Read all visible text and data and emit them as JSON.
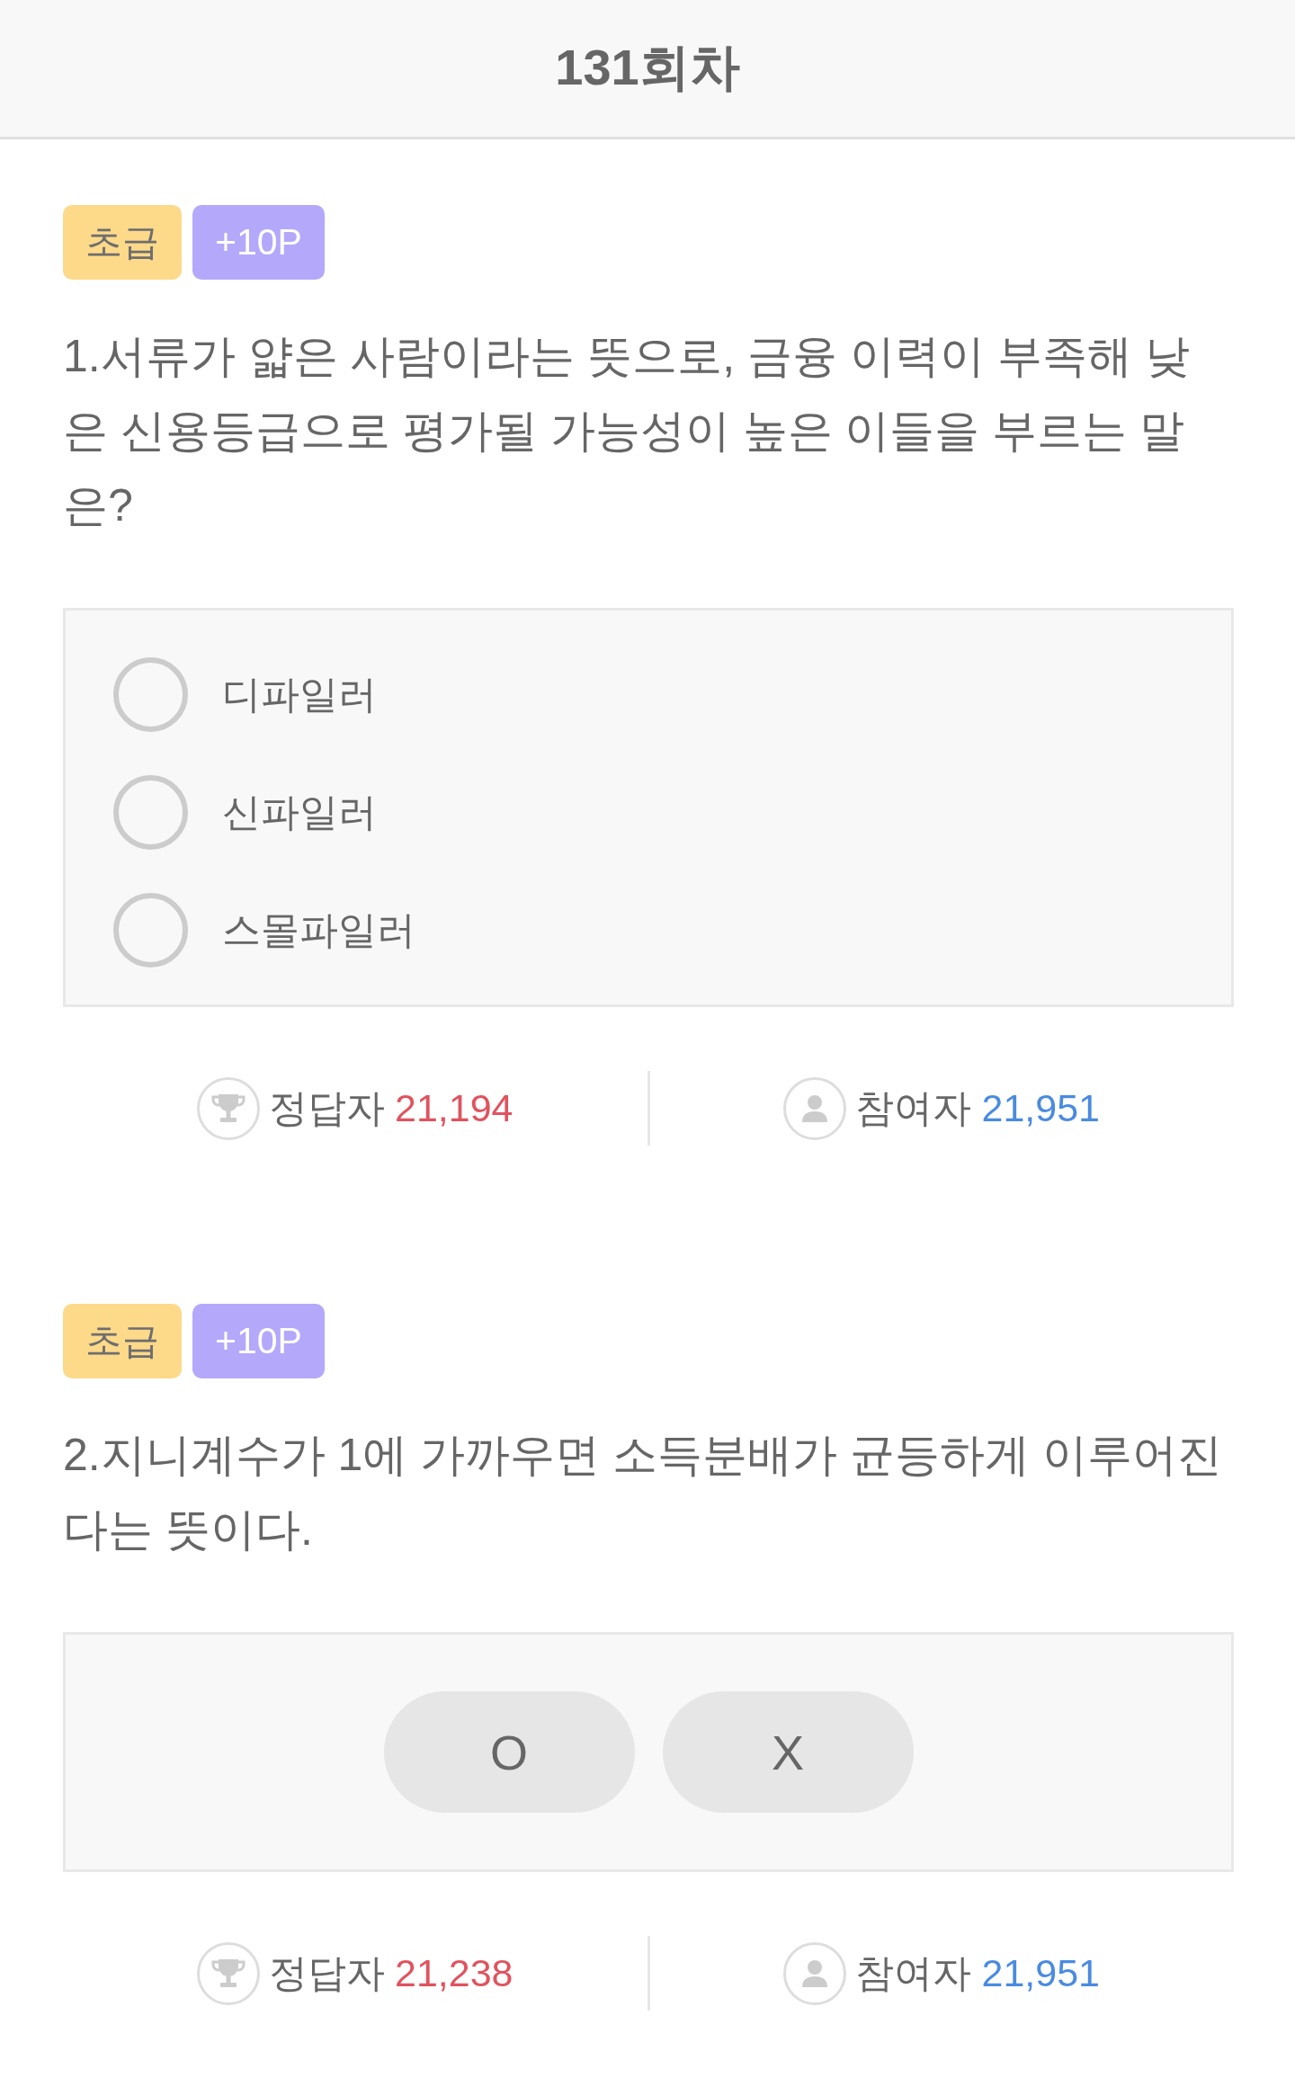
{
  "header": {
    "title": "131회차"
  },
  "questions": [
    {
      "kind": "choice",
      "badges": [
        {
          "kind": "level",
          "label": "초급"
        },
        {
          "kind": "points",
          "label": "+10P"
        }
      ],
      "text": "1.서류가 얇은 사람이라는 뜻으로, 금융 이력이 부족해 낮은 신용등급으로 평가될 가능성이 높은 이들을 부르는 말은?",
      "options": [
        {
          "label": "디파일러",
          "selected": false
        },
        {
          "label": "신파일러",
          "selected": false
        },
        {
          "label": "스몰파일러",
          "selected": false
        }
      ],
      "stats": [
        {
          "kind": "correct",
          "label": "정답자",
          "count": "21,194"
        },
        {
          "kind": "participants",
          "label": "참여자",
          "count": "21,951"
        }
      ]
    },
    {
      "kind": "ox",
      "badges": [
        {
          "kind": "level",
          "label": "초급"
        },
        {
          "kind": "points",
          "label": "+10P"
        }
      ],
      "text": "2.지니계수가 1에 가까우면 소득분배가 균등하게 이루어진다는 뜻이다.",
      "answers": [
        {
          "label": "O",
          "selected": false
        },
        {
          "label": "X",
          "selected": false
        }
      ],
      "stats": [
        {
          "kind": "correct",
          "label": "정답자",
          "count": "21,238"
        },
        {
          "kind": "participants",
          "label": "참여자",
          "count": "21,951"
        }
      ]
    }
  ]
}
